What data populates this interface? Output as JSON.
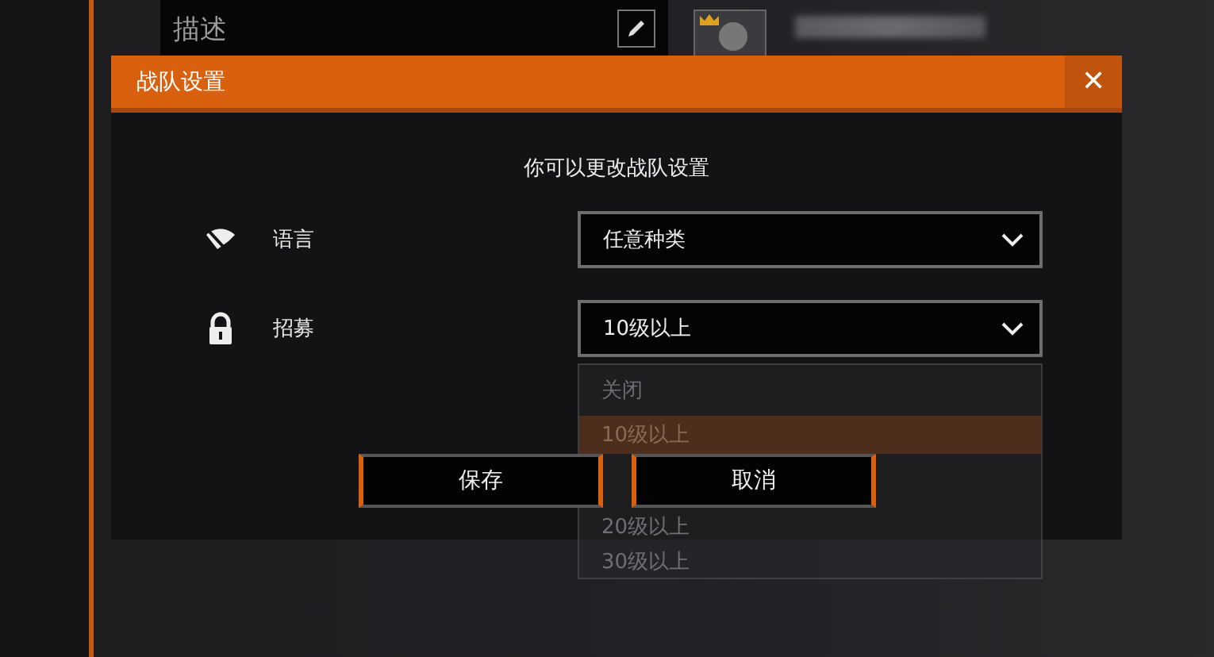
{
  "background": {
    "description_panel": {
      "title": "描述"
    }
  },
  "dialog": {
    "title": "战队设置",
    "close": "✕",
    "subtitle": "你可以更改战队设置",
    "fields": [
      {
        "kind": "language",
        "label": "语言",
        "value": "任意种类"
      },
      {
        "kind": "recruit",
        "label": "招募",
        "value": "10级以上"
      }
    ],
    "dropdown": {
      "options": [
        {
          "label": "关闭",
          "selected": false
        },
        {
          "label": "10级以上",
          "selected": true
        },
        {
          "label": "20级以上",
          "selected": false
        },
        {
          "label": "30级以上",
          "selected": false
        }
      ]
    },
    "buttons": [
      {
        "label": "保存"
      },
      {
        "label": "取消"
      }
    ]
  }
}
